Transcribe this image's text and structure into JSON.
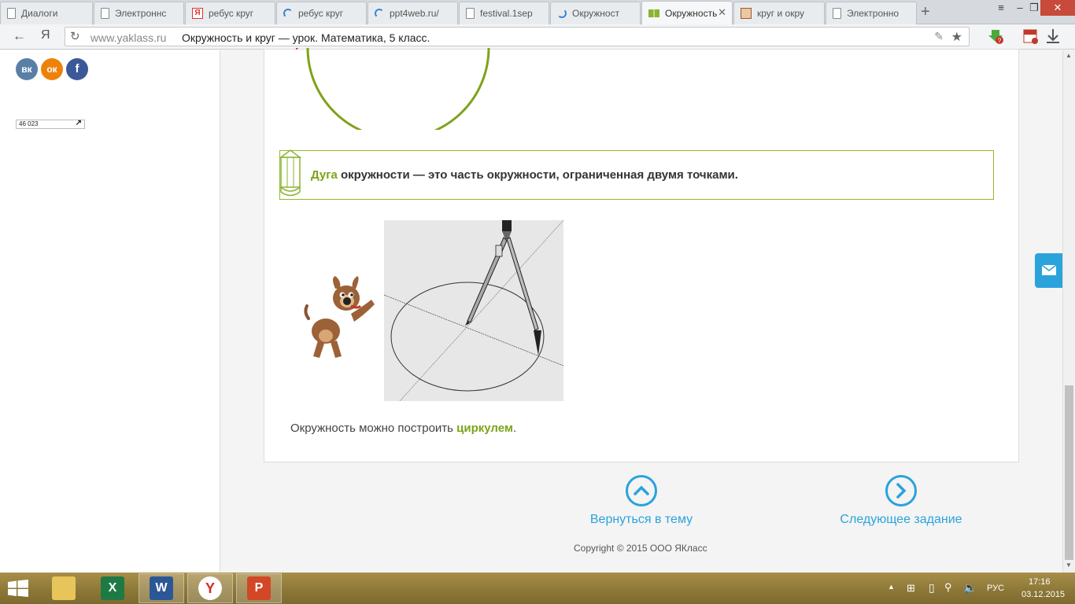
{
  "browser": {
    "tabs": [
      {
        "label": "Диалоги",
        "icon": "document-icon",
        "active": false
      },
      {
        "label": "Электроннс",
        "icon": "document-icon",
        "active": false
      },
      {
        "label": "ребус круг",
        "icon": "yandex-icon",
        "active": false
      },
      {
        "label": "ребус круг",
        "icon": "loading-icon",
        "active": false
      },
      {
        "label": "ppt4web.ru/",
        "icon": "loading-icon",
        "active": false
      },
      {
        "label": "festival.1sep",
        "icon": "document-icon",
        "active": false
      },
      {
        "label": "Окружност",
        "icon": "loading-icon",
        "active": false
      },
      {
        "label": "Окружность",
        "icon": "yaklass-icon",
        "active": true
      },
      {
        "label": "круг и окру",
        "icon": "image-icon",
        "active": false
      },
      {
        "label": "Электронно",
        "icon": "document-icon",
        "active": false
      }
    ],
    "new_tab": "+",
    "address": {
      "host": "www.yaklass.ru",
      "page_title": "Окружность и круг — урок. Математика, 5 класс."
    },
    "logo": "Я"
  },
  "sidebar": {
    "social": [
      {
        "label": "вк",
        "color": "#5a7fa6"
      },
      {
        "label": "ок",
        "color": "#ee8208"
      },
      {
        "label": "f",
        "color": "#3b5998"
      }
    ],
    "counter_value": "46 023"
  },
  "lesson": {
    "definition": {
      "term": "Дуга",
      "rest": " окружности — это часть окружности, ограниченная двумя точками."
    },
    "caption": {
      "before": "Окружность можно построить ",
      "term": "циркулем",
      "after": "."
    }
  },
  "nav": {
    "back_label": "Вернуться в тему",
    "next_label": "Следующее задание"
  },
  "footer": {
    "copyright": "Copyright © 2015 ООО ЯКласс"
  },
  "taskbar": {
    "lang": "РУС",
    "time": "17:16",
    "date": "03.12.2015"
  },
  "colors": {
    "accent_green": "#7ea31a",
    "link_blue": "#2aa3dc"
  }
}
